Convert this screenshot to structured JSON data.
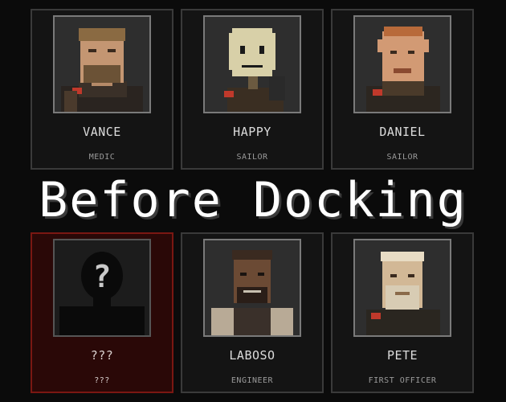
{
  "title": "Before Docking",
  "crew": [
    {
      "name": "VANCE",
      "role": "MEDIC",
      "portrait_icon": "vance-portrait",
      "locked": false
    },
    {
      "name": "HAPPY",
      "role": "SAILOR",
      "portrait_icon": "happy-portrait",
      "locked": false
    },
    {
      "name": "DANIEL",
      "role": "SAILOR",
      "portrait_icon": "daniel-portrait",
      "locked": false
    },
    {
      "name": "???",
      "role": "???",
      "portrait_icon": "unknown-silhouette",
      "locked": true
    },
    {
      "name": "LABOSO",
      "role": "ENGINEER",
      "portrait_icon": "laboso-portrait",
      "locked": false
    },
    {
      "name": "PETE",
      "role": "FIRST OFFICER",
      "portrait_icon": "pete-portrait",
      "locked": false
    }
  ],
  "colors": {
    "background": "#0b0b0b",
    "card": "#141414",
    "card_border": "#3a3a3a",
    "locked_card": "#2a0807",
    "locked_border": "#7a1712"
  }
}
